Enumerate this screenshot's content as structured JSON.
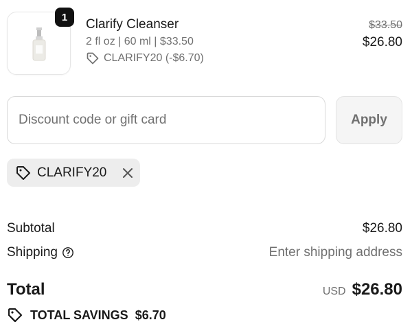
{
  "line_item": {
    "quantity": "1",
    "name": "Clarify Cleanser",
    "variant": "2 fl oz | 60 ml | $33.50",
    "discount": "CLARIFY20 (-$6.70)",
    "price_original": "$33.50",
    "price_final": "$26.80"
  },
  "discount_field": {
    "placeholder": "Discount code or gift card",
    "value": "",
    "apply_label": "Apply"
  },
  "applied_code": {
    "label": "CLARIFY20"
  },
  "summary": {
    "subtotal_label": "Subtotal",
    "subtotal_value": "$26.80",
    "shipping_label": "Shipping",
    "shipping_value": "Enter shipping address",
    "total_label": "Total",
    "currency": "USD",
    "total_value": "$26.80",
    "savings_label": "TOTAL SAVINGS",
    "savings_value": "$6.70"
  },
  "icons": {
    "tag": "tag-icon",
    "close": "close-icon",
    "help": "help-circle-icon",
    "bottle": "product-bottle"
  },
  "colors": {
    "text": "#1a1a1a",
    "muted": "#707070",
    "badge": "#111111",
    "chip_bg": "#ededed",
    "button_bg": "#f5f5f5"
  }
}
